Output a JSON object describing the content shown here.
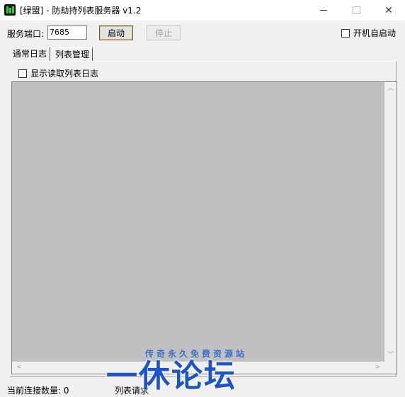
{
  "window": {
    "title": "[绿盟] - 防劫持列表服务器 v1.2",
    "minimize": "—",
    "maximize": "☐",
    "close": "✕"
  },
  "toolbar": {
    "port_label": "服务端口:",
    "port_value": "7685",
    "start_label": "启动",
    "stop_label": "停止",
    "autostart_label": "开机自启动"
  },
  "tabs": [
    {
      "label": "通常日志",
      "active": true
    },
    {
      "label": "列表管理",
      "active": false
    }
  ],
  "log_panel": {
    "show_read_log_label": "显示读取列表日志"
  },
  "status": {
    "connections": "当前连接数量: 0",
    "requests": "列表请求"
  },
  "watermark": {
    "small": "传奇永久免费资源站",
    "big": "一休论坛"
  },
  "colors": {
    "log_background": "#c0c0c0",
    "watermark_blue": "#1a55c9"
  }
}
